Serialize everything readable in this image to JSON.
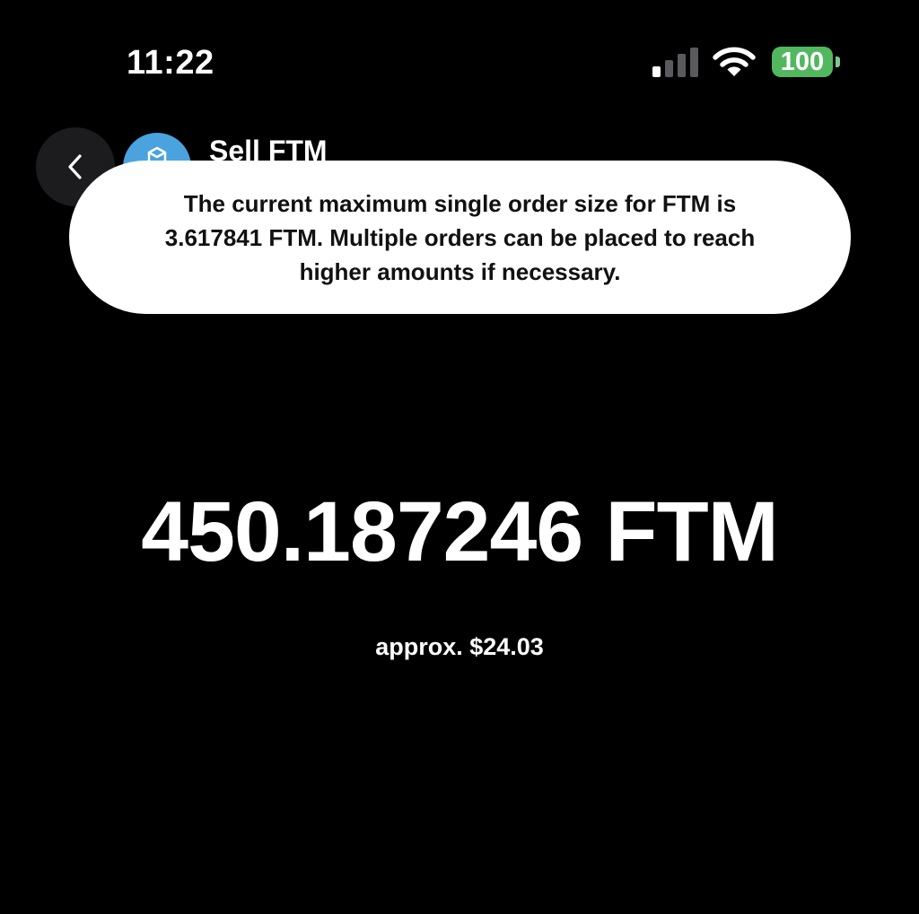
{
  "status_bar": {
    "time": "11:22",
    "battery_level": "100",
    "signal_bars_active": 1,
    "signal_bars_total": 4,
    "colors": {
      "battery_fill": "#52b860",
      "signal_active": "#ffffff",
      "signal_inactive": "#5a5a5e"
    },
    "icons": [
      "cellular-signal-icon",
      "wifi-icon",
      "battery-icon"
    ]
  },
  "header": {
    "title": "Sell FTM",
    "back_icon": "chevron-left-icon",
    "avatar_icon": "fantom-coin-icon",
    "avatar_color": "#4aa3df"
  },
  "toast": {
    "message": "The current maximum single order size for FTM is 3.617841 FTM. Multiple orders can be placed to reach higher amounts if necessary."
  },
  "order": {
    "amount": "450.187246 FTM",
    "approx_value": "approx. $24.03"
  }
}
